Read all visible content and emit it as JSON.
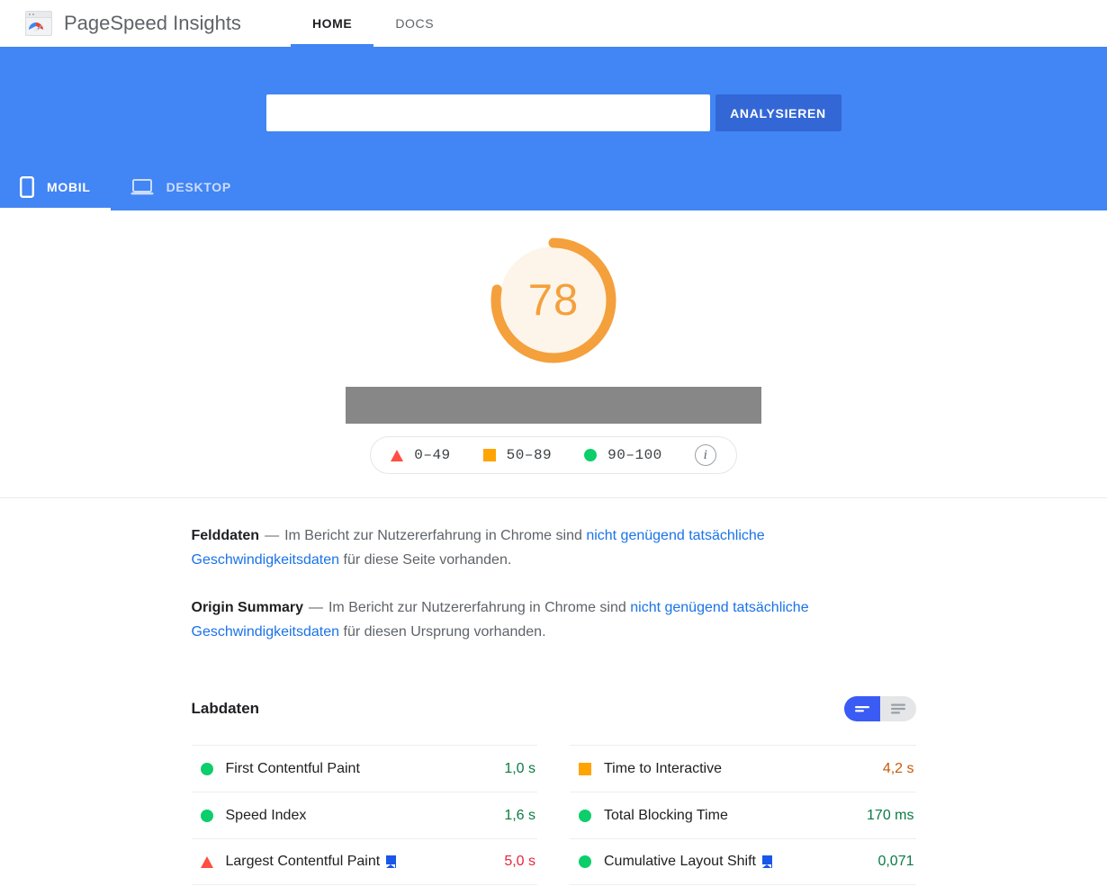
{
  "colors": {
    "hero_blue": "#4285f4",
    "button_blue": "#3367d6",
    "link_blue": "#1a73e8",
    "score_orange": "#f4a03c",
    "good_green": "#0cce6b",
    "average_orange": "#ffa400",
    "poor_red": "#ff4e42",
    "gray_bar": "#878787",
    "badge_blue": "#1a56e8"
  },
  "header": {
    "logo_icon": "pagespeed-gauge-logo",
    "brand_title": "PageSpeed Insights",
    "tabs": [
      {
        "label": "HOME",
        "active": true
      },
      {
        "label": "DOCS",
        "active": false
      }
    ]
  },
  "hero": {
    "search": {
      "value": "",
      "placeholder": ""
    },
    "analyze_label": "ANALYSIEREN",
    "device_tabs": [
      {
        "label": "MOBIL",
        "icon": "mobile-phone-icon",
        "active": true
      },
      {
        "label": "DESKTOP",
        "icon": "laptop-icon",
        "active": false
      }
    ]
  },
  "score": {
    "value": "78",
    "percent": 78,
    "legend": [
      {
        "icon": "triangle-swatch",
        "range": "0–49"
      },
      {
        "icon": "square-swatch",
        "range": "50–89"
      },
      {
        "icon": "circle-swatch",
        "range": "90–100"
      }
    ],
    "info_icon": "info-icon",
    "info_glyph": "i"
  },
  "field_data": {
    "title": "Felddaten",
    "dash": "—",
    "text_before": "Im Bericht zur Nutzererfahrung in Chrome sind ",
    "link_text": "nicht genügend tatsächliche Geschwindigkeitsdaten",
    "text_after": " für diese Seite vorhanden."
  },
  "origin_summary": {
    "title": "Origin Summary",
    "dash": "—",
    "text_before": "Im Bericht zur Nutzererfahrung in Chrome sind ",
    "link_text": "nicht genügend tatsächliche Geschwindigkeitsdaten",
    "text_after": " für diesen Ursprung vorhanden."
  },
  "lab_data": {
    "title": "Labdaten",
    "view_toggle": [
      {
        "icon": "condensed-view-icon",
        "active": true
      },
      {
        "icon": "expanded-view-icon",
        "active": false
      }
    ],
    "left_column": [
      {
        "status": "good",
        "label": "First Contentful Paint",
        "badge": false,
        "value": "1,0 s"
      },
      {
        "status": "good",
        "label": "Speed Index",
        "badge": false,
        "value": "1,6 s"
      },
      {
        "status": "poor",
        "label": "Largest Contentful Paint",
        "badge": true,
        "value": "5,0 s"
      }
    ],
    "right_column": [
      {
        "status": "average",
        "label": "Time to Interactive",
        "badge": false,
        "value": "4,2 s"
      },
      {
        "status": "good",
        "label": "Total Blocking Time",
        "badge": false,
        "value": "170 ms"
      },
      {
        "status": "good",
        "label": "Cumulative Layout Shift",
        "badge": true,
        "value": "0,071"
      }
    ]
  }
}
